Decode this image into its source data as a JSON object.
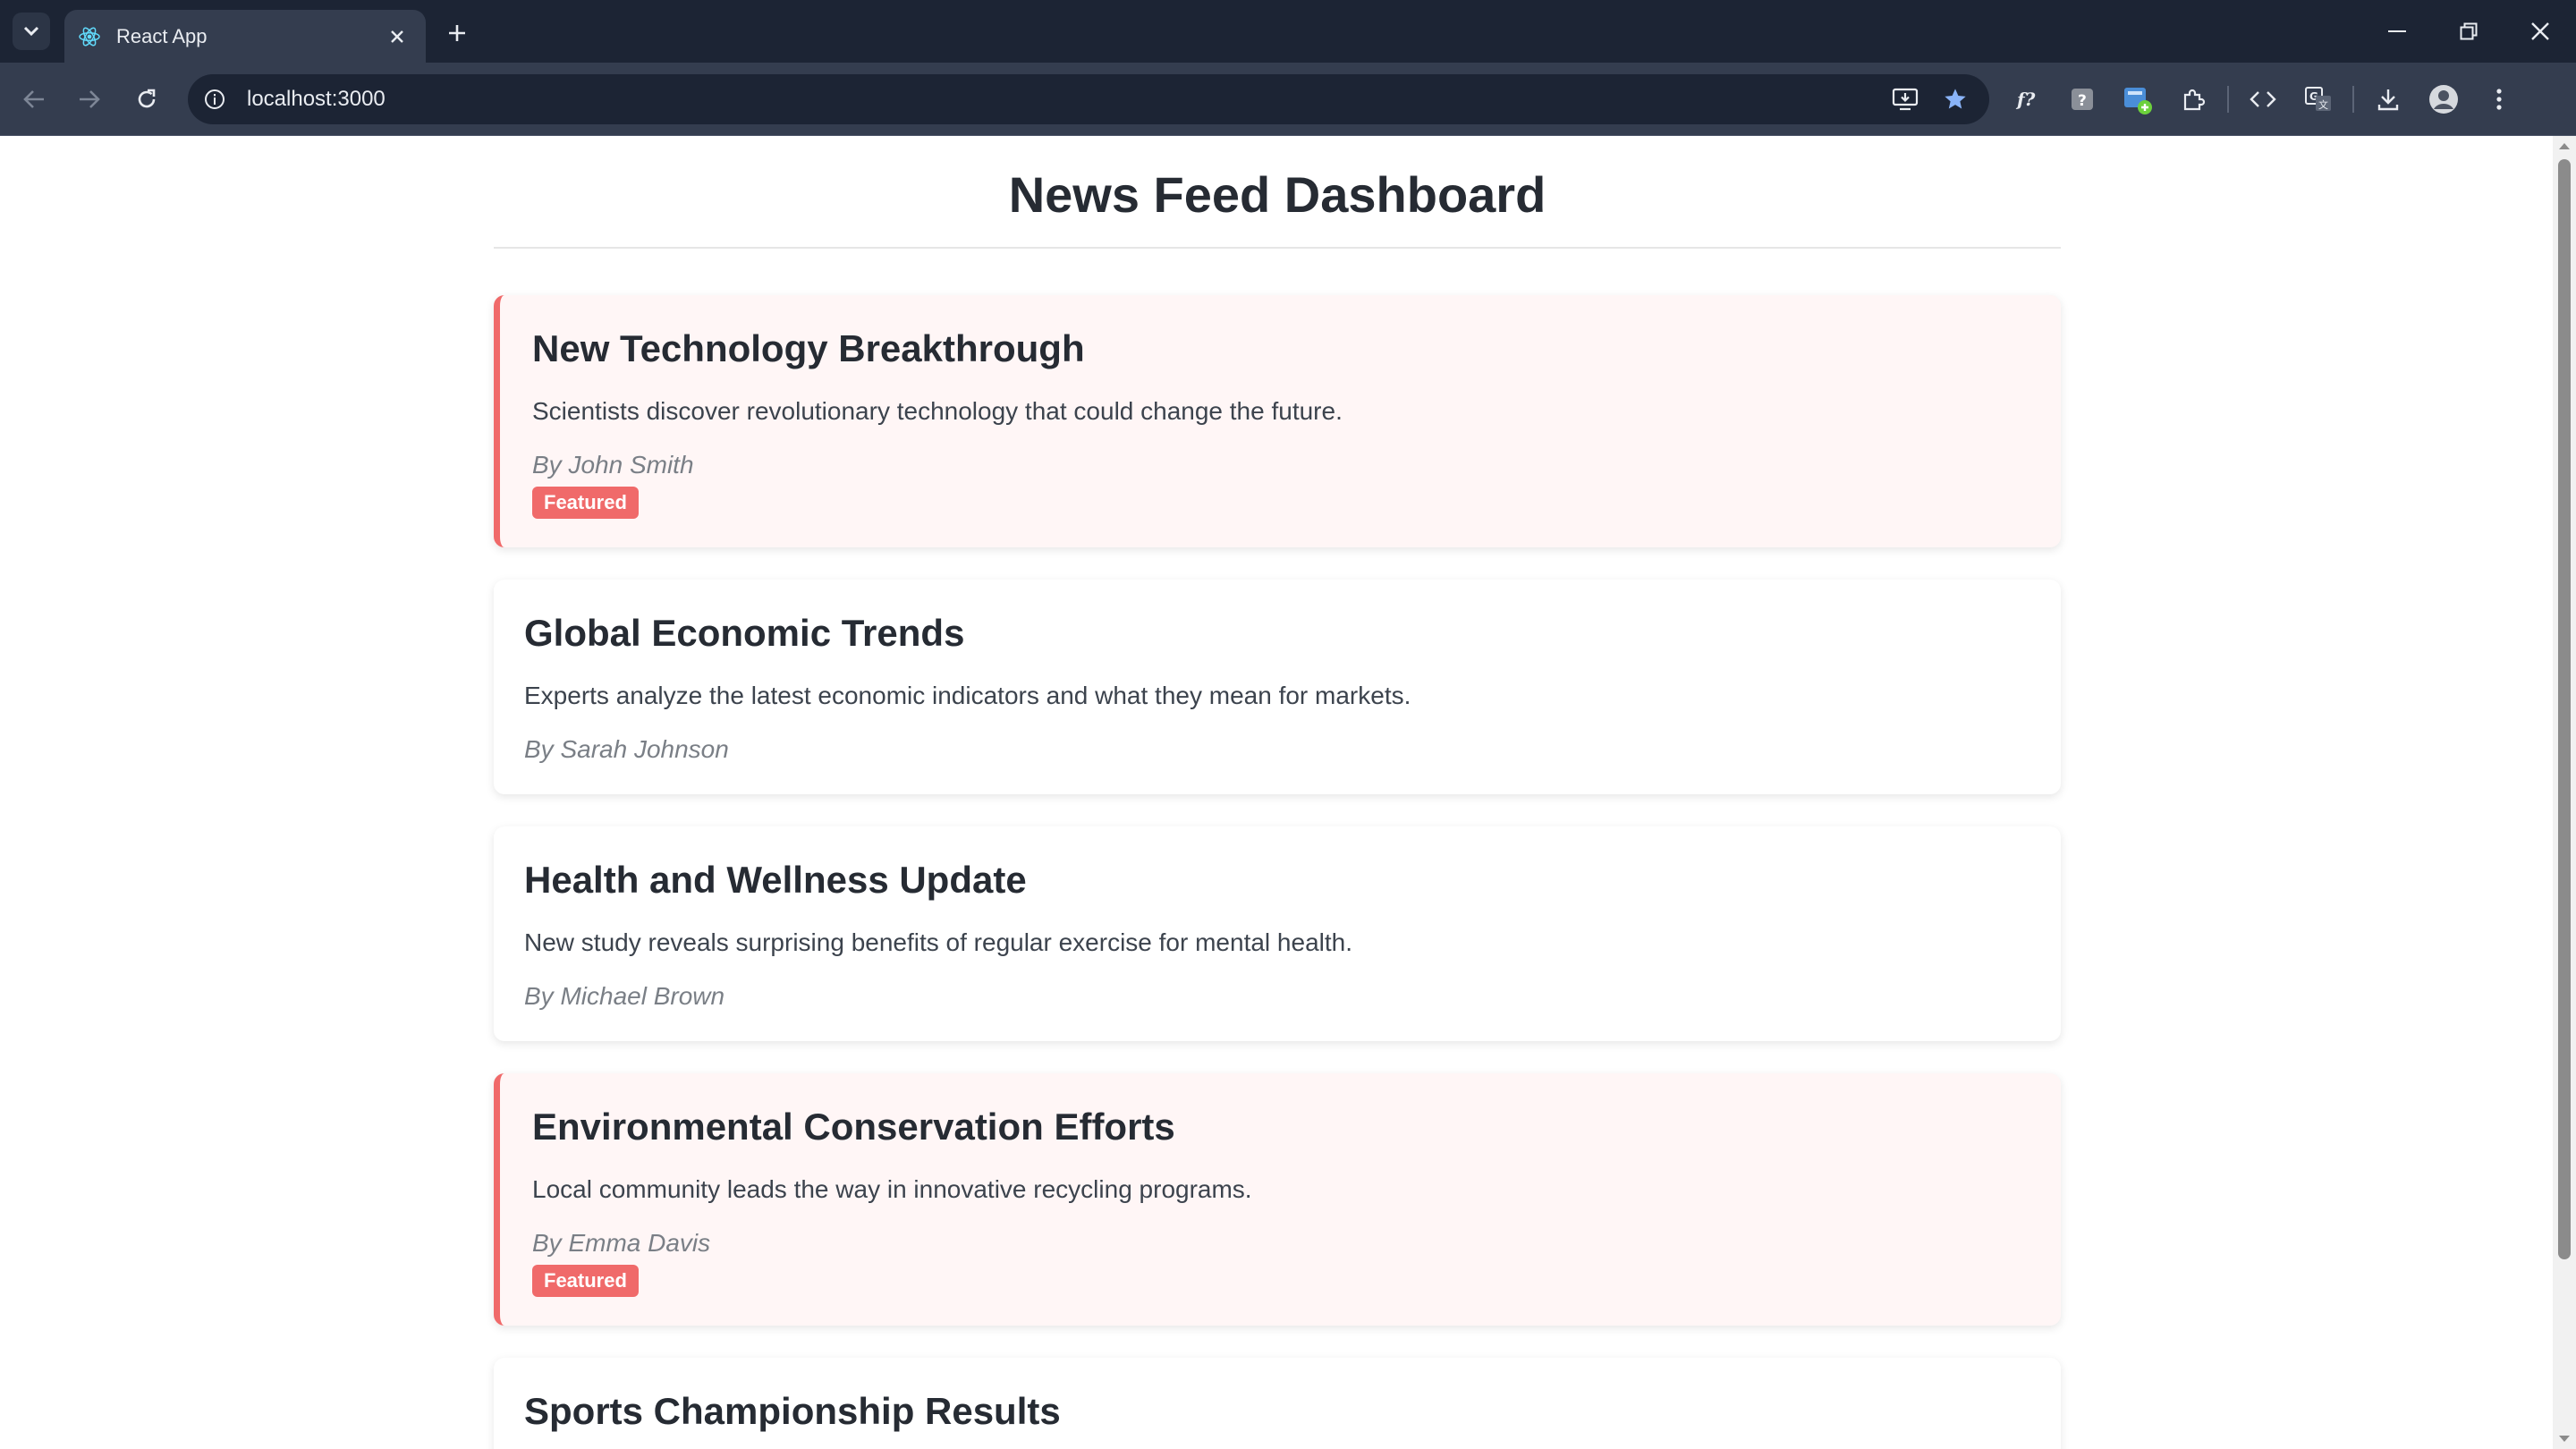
{
  "browser": {
    "tab_title": "React App",
    "url": "localhost:3000"
  },
  "page": {
    "title": "News Feed Dashboard"
  },
  "articles": [
    {
      "title": "New Technology Breakthrough",
      "summary": "Scientists discover revolutionary technology that could change the future.",
      "author": "By John Smith",
      "featured": true,
      "badge": "Featured"
    },
    {
      "title": "Global Economic Trends",
      "summary": "Experts analyze the latest economic indicators and what they mean for markets.",
      "author": "By Sarah Johnson",
      "featured": false
    },
    {
      "title": "Health and Wellness Update",
      "summary": "New study reveals surprising benefits of regular exercise for mental health.",
      "author": "By Michael Brown",
      "featured": false
    },
    {
      "title": "Environmental Conservation Efforts",
      "summary": "Local community leads the way in innovative recycling programs.",
      "author": "By Emma Davis",
      "featured": true,
      "badge": "Featured"
    },
    {
      "title": "Sports Championship Results",
      "featured": false
    }
  ],
  "colors": {
    "accent": "#f06a6a",
    "featured_bg": "#fff6f6",
    "chrome_dark": "#1c2434",
    "chrome": "#343d4f"
  }
}
